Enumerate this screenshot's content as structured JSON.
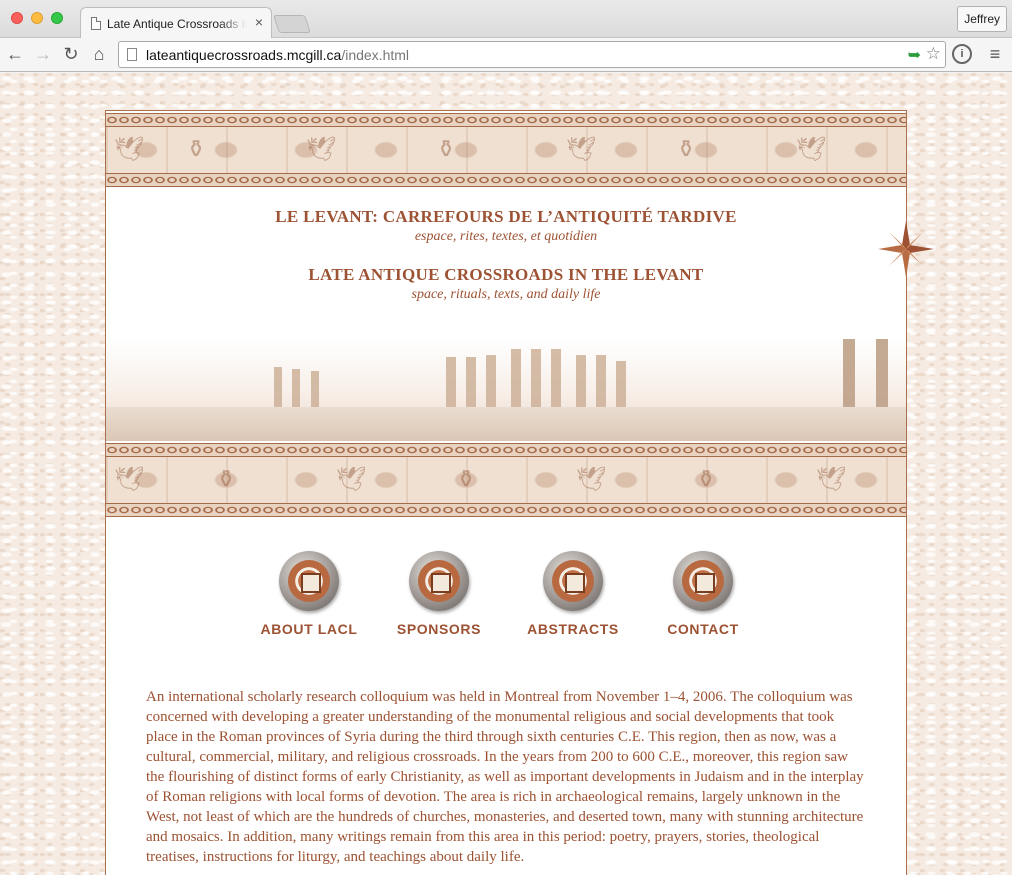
{
  "browser": {
    "tab_title": "Late Antique Crossroads in",
    "tab_close": "×",
    "profile": "Jeffrey",
    "url_host": "lateantiquecrossroads.mcgill.ca",
    "url_path": "/index.html",
    "icons": [
      "back-arrow-icon",
      "forward-arrow-icon",
      "reload-icon",
      "home-icon",
      "page-icon",
      "bookmark-star-icon",
      "extension-icon",
      "menu-icon"
    ]
  },
  "site": {
    "title_fr": "LE LEVANT: CARREFOURS DE L’ANTIQUITÉ TARDIVE",
    "subtitle_fr": "espace, rites, textes, et quotidien",
    "title_en": "LATE ANTIQUE CROSSROADS IN THE LEVANT",
    "subtitle_en": "space, rituals, texts, and daily life",
    "accent_color": "#9c5233",
    "nav": [
      {
        "label": "ABOUT LACL"
      },
      {
        "label": "SPONSORS"
      },
      {
        "label": "ABSTRACTS"
      },
      {
        "label": "CONTACT"
      }
    ],
    "intro": "An international scholarly research colloquium was held in Montreal from November 1–4, 2006. The colloquium was concerned with developing a greater understanding of the monumental religious and social developments that took place in the Roman provinces of Syria during the third through sixth centuries C.E. This region, then as now, was a cultural, commercial, military, and religious crossroads. In the years from 200 to 600 C.E., moreover, this region saw the flourishing of distinct forms of early Christianity, as well as important developments in Judaism and in the interplay of Roman religions with local forms of devotion. The area is rich in archaeological remains, largely unknown in the West, not least of which are the hundreds of churches, monasteries, and deserted town, many with stunning architecture and mosaics. In addition, many writings remain from this area in this period: poetry, prayers, stories, theological treatises, instructions for liturgy, and teachings about daily life."
  }
}
